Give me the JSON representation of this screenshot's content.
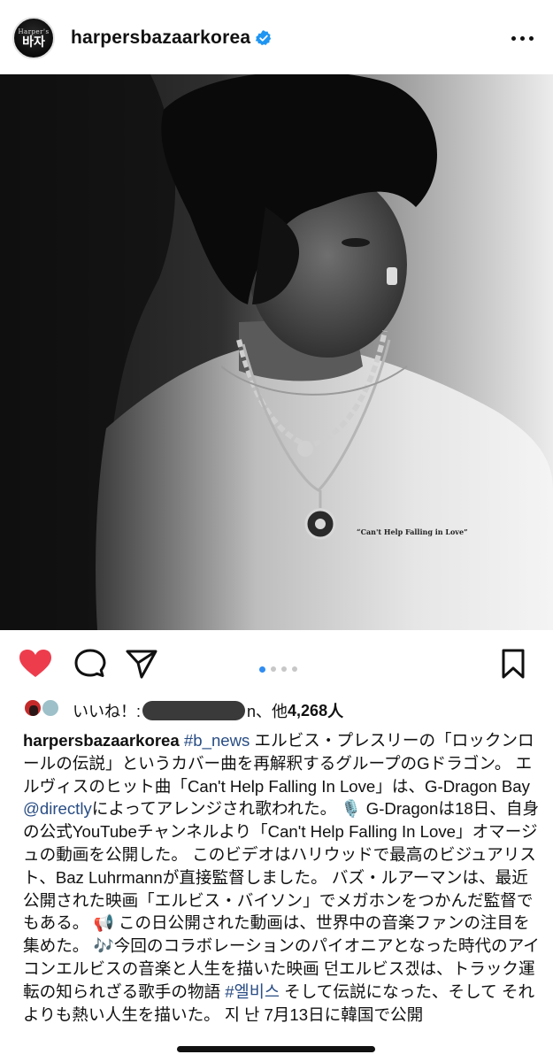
{
  "header": {
    "avatar_small": "Harper's",
    "avatar_big": "바자",
    "username": "harpersbazaarkorea",
    "verified_icon": "verified-badge-icon",
    "more_icon": "more-options-icon"
  },
  "photo": {
    "shirt_text": "“Can't Help Falling in Love”"
  },
  "actions": {
    "like_icon": "heart-filled-icon",
    "comment_icon": "comment-icon",
    "share_icon": "send-icon",
    "save_icon": "bookmark-icon",
    "carousel_count": 4,
    "carousel_active": 0,
    "colors": {
      "heart": "#ed3d4d",
      "active_dot": "#2f8cf2",
      "dot": "#c7c7c7"
    }
  },
  "likes": {
    "prefix": "いいね！:",
    "suffix_tail": "n、他",
    "count": "4,268",
    "unit": "人"
  },
  "caption": {
    "username": "harpersbazaarkorea",
    "hashtag1": "#b_news",
    "part1": " エルビス・プレスリーの「ロックンロールの伝説」というカバー曲を再解釈するグループのGドラゴン。 エルヴィスのヒット曲「Can't Help Falling In Love」は、G-Dragon Bay ",
    "mention": "@directly",
    "part2": "によってアレンジされ歌われた。 🎙️ G-Dragonは18日、自身の公式YouTubeチャンネルより「Can't Help Falling In Love」オマージュの動画を公開した。 このビデオはハリウッドで最高のビジュアリスト、Baz Luhrmannが直接監督しました。 バズ・ルアーマンは、最近公開された映画「エルビス・バイソン」でメガホンをつかんだ監督でもある。 📢 この日公開された動画は、世界中の音楽ファンの注目を集めた。 🎶今回のコラボレーションのパイオニアとなった時代のアイコンエルビスの音楽と人生を描いた映画 던エルビス겠は、トラック運転の知られざる歌手の物語 ",
    "hashtag2": "#엘비스",
    "part3": " そして伝説になった、そして それよりも熱い人生を描いた。 지 난 7月13日に韓国で公開"
  },
  "link_color": "#294d84"
}
